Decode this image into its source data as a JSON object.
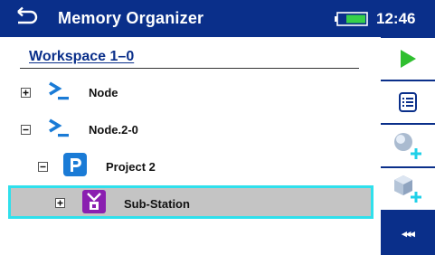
{
  "header": {
    "title": "Memory Organizer",
    "time": "12:46"
  },
  "workspace": {
    "title": "Workspace 1–0"
  },
  "tree": [
    {
      "label": "Node",
      "expander": "plus",
      "icon": "node-icon"
    },
    {
      "label": "Node.2-0",
      "expander": "minus",
      "icon": "node-icon"
    },
    {
      "label": "Project 2",
      "expander": "minus",
      "icon": "project-icon"
    },
    {
      "label": "Sub-Station",
      "expander": "plus",
      "icon": "substation-icon",
      "selected": true
    }
  ],
  "sidebar": {
    "buttons": [
      "play-icon",
      "list-icon",
      "add-structure-icon",
      "add-object-icon",
      "more-icon"
    ],
    "more_label": "◂◂◂"
  },
  "colors": {
    "header": "#0a2f8a",
    "accent_green": "#2fbf2f",
    "selection_border": "#2fe0ec",
    "icon_blue": "#1a7bd6",
    "substation_purple": "#8a1fb0"
  }
}
